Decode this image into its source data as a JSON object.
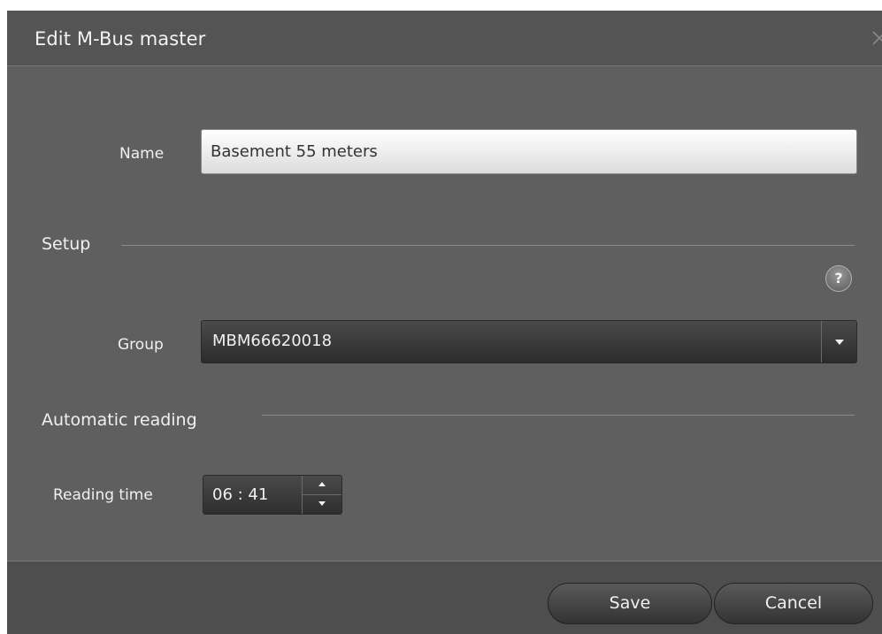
{
  "dialog": {
    "title": "Edit M-Bus master"
  },
  "form": {
    "name_label": "Name",
    "name_value": "Basement 55 meters",
    "setup_heading": "Setup",
    "help_symbol": "?",
    "group_label": "Group",
    "group_value": "MBM66620018",
    "automatic_reading_heading": "Automatic reading",
    "reading_time_label": "Reading time",
    "reading_time_value": "06 : 41"
  },
  "footer": {
    "save_label": "Save",
    "cancel_label": "Cancel"
  },
  "icons": {
    "close": "close-icon",
    "help": "help-icon",
    "dropdown": "chevron-down-icon",
    "spin_up": "arrow-up-icon",
    "spin_down": "arrow-down-icon"
  }
}
